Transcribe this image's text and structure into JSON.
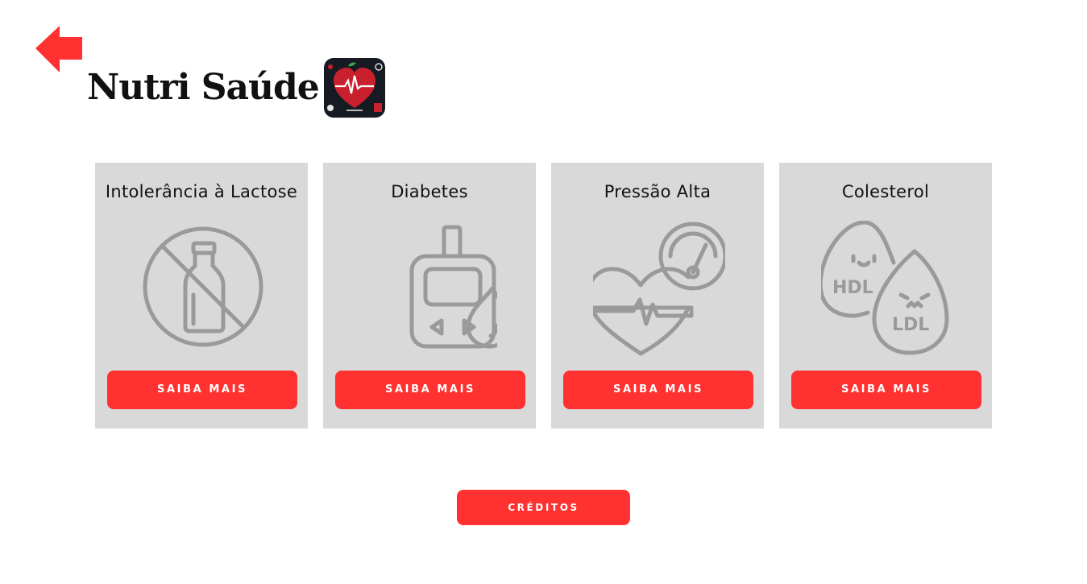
{
  "header": {
    "back_icon": "arrow-left-icon",
    "title": "Nutri Saúde",
    "logo_icon": "heart-fruit-logo-icon"
  },
  "cards": [
    {
      "title": "Intolerância à Lactose",
      "icon": "no-milk-bottle-icon",
      "button_label": "SAIBA MAIS"
    },
    {
      "title": "Diabetes",
      "icon": "glucometer-drop-icon",
      "button_label": "SAIBA MAIS"
    },
    {
      "title": "Pressão Alta",
      "icon": "heart-pressure-gauge-icon",
      "button_label": "SAIBA MAIS"
    },
    {
      "title": "Colesterol",
      "icon": "hdl-ldl-drops-icon",
      "button_label": "SAIBA MAIS"
    }
  ],
  "footer": {
    "credits_label": "CRÉDITOS"
  },
  "colors": {
    "accent": "#ff3131",
    "card_bg": "#d9d9d9",
    "icon_stroke": "#9a9a9a",
    "text": "#111111"
  }
}
